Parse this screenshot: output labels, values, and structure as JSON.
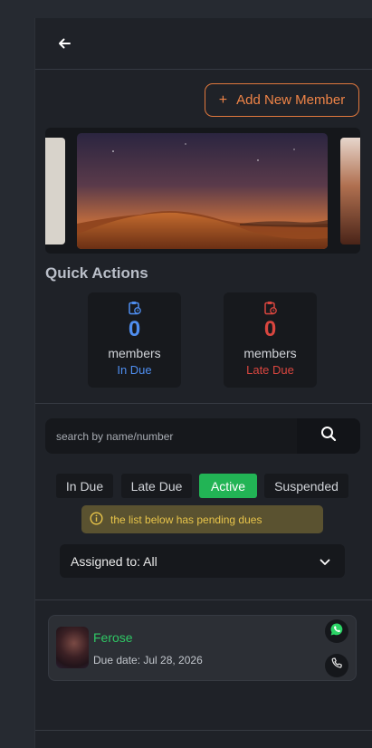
{
  "header": {
    "back_icon": "arrow-left-icon"
  },
  "actions": {
    "add_member_label": "Add New Member",
    "add_icon": "plus-icon"
  },
  "carousel": {
    "slides": [
      "portrait-slide",
      "desert-night-slide",
      "portrait-slide"
    ]
  },
  "quick_actions": {
    "title": "Quick Actions",
    "cards": [
      {
        "icon": "clipboard-clock-icon",
        "count": "0",
        "label": "members",
        "status": "In Due",
        "color": "#4f8ef0"
      },
      {
        "icon": "clipboard-clock-icon",
        "count": "0",
        "label": "members",
        "status": "Late Due",
        "color": "#d9463f"
      }
    ]
  },
  "search": {
    "placeholder": "search by name/number",
    "icon": "search-icon"
  },
  "filters": {
    "tabs": [
      "In Due",
      "Late Due",
      "Active",
      "Suspended"
    ],
    "selected": "Active",
    "active_color": "#22b455"
  },
  "notice": {
    "icon": "info-icon",
    "text": "the list below has pending dues"
  },
  "assigned": {
    "label": "Assigned to: All",
    "icon": "chevron-down-icon"
  },
  "members": [
    {
      "name": "Ferose",
      "due_date": "Due date: Jul 28, 2026",
      "actions": [
        "whatsapp-icon",
        "phone-icon"
      ]
    }
  ]
}
